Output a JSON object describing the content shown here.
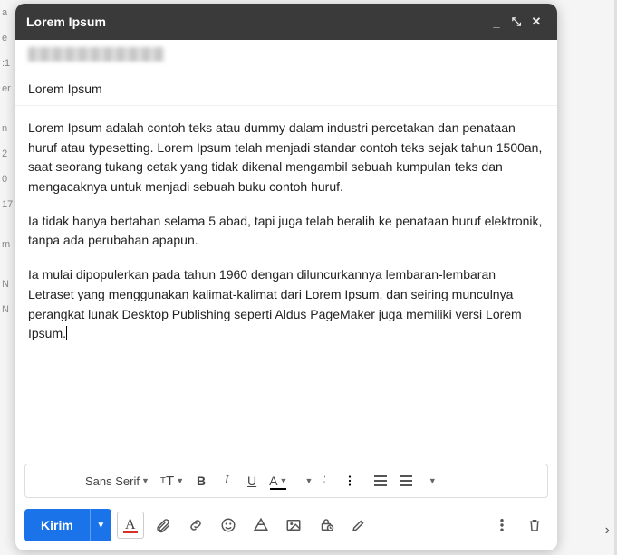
{
  "window": {
    "title": "Lorem Ipsum"
  },
  "subject": "Lorem Ipsum",
  "body": {
    "p1": "Lorem Ipsum adalah contoh teks atau dummy dalam industri percetakan dan penataan huruf atau typesetting. Lorem Ipsum telah menjadi standar contoh teks sejak tahun 1500an, saat seorang tukang cetak yang tidak dikenal mengambil sebuah kumpulan teks dan mengacaknya untuk menjadi sebuah buku contoh huruf.",
    "p2": "Ia tidak hanya bertahan selama 5 abad, tapi juga telah beralih ke penataan huruf elektronik, tanpa ada perubahan apapun.",
    "p3": "Ia mulai dipopulerkan pada tahun 1960 dengan diluncurkannya lembaran-lembaran Letraset yang menggunakan kalimat-kalimat dari Lorem Ipsum, dan seiring munculnya perangkat lunak Desktop Publishing seperti Aldus PageMaker juga memiliki versi Lorem Ipsum."
  },
  "format_toolbar": {
    "font": "Sans Serif",
    "bold": "B",
    "italic": "I",
    "underline": "U",
    "text_color": "A"
  },
  "bottom_bar": {
    "send": "Kirim",
    "format_A": "A"
  },
  "bg_rows": [
    "a",
    "e",
    "1",
    "er",
    "",
    "n",
    "2",
    "0",
    "17",
    "",
    "m",
    "",
    "N",
    "N"
  ]
}
